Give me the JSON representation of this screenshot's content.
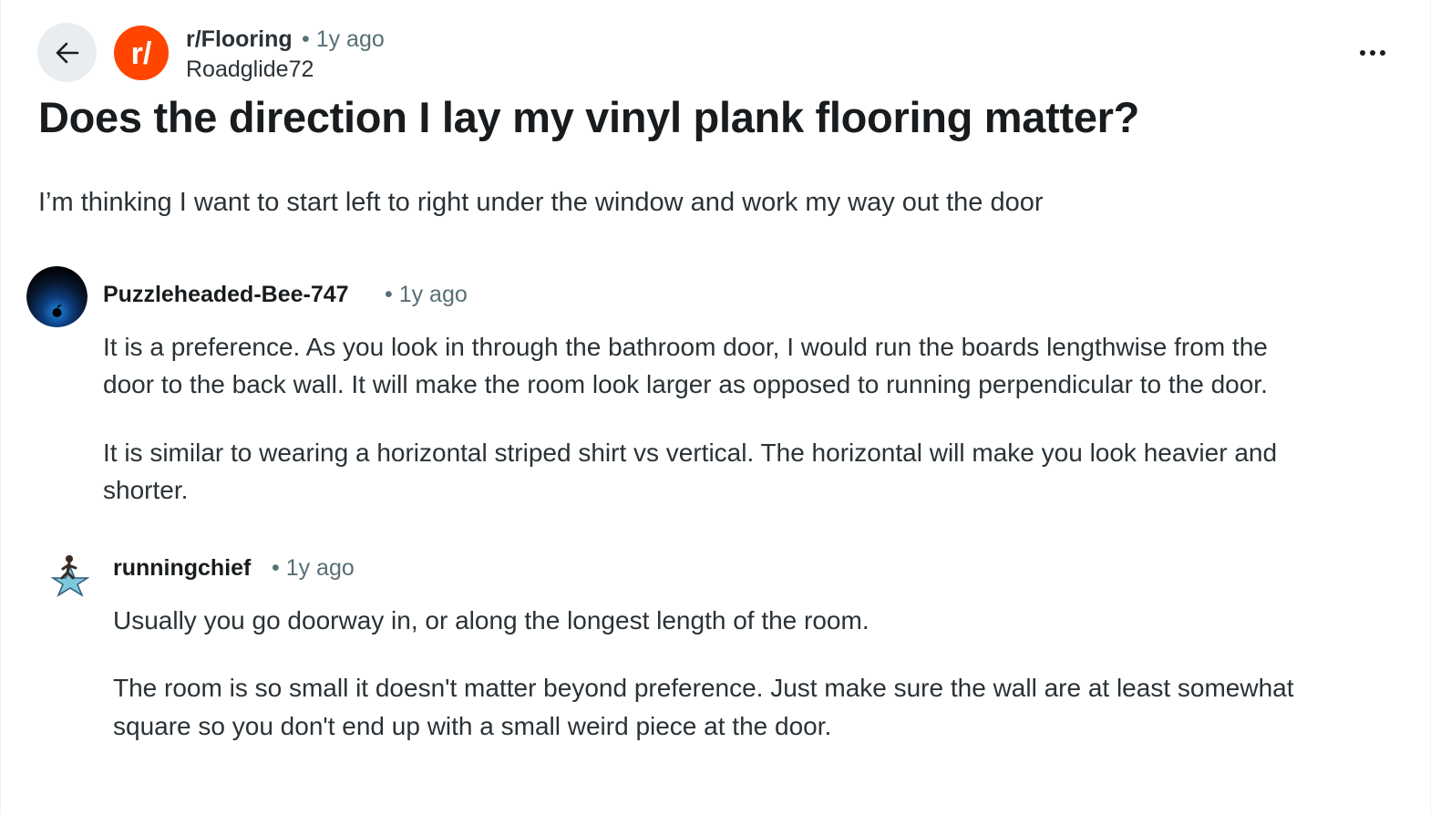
{
  "header": {
    "back_icon": "arrow-left-icon",
    "subreddit": "r/Flooring",
    "post_age": "• 1y ago",
    "author": "Roadglide72",
    "subreddit_icon_text": "r/",
    "subreddit_icon_color": "#ff4500",
    "more_icon": "more-horizontal-icon"
  },
  "post": {
    "title": "Does the direction I lay my vinyl plank flooring matter?",
    "body": "I’m thinking I want to start left to right under the window and work my way out the door"
  },
  "comments": [
    {
      "username": "Puzzleheaded-Bee-747",
      "age": "• 1y ago",
      "avatar_icon": "dark-planet-avatar",
      "paragraphs": [
        {
          "line1": "It is a preference. As you look in through the bathroom door, I would run the boards lengthwise from the",
          "line2": "door to the back wall. It will make the room look larger as opposed to running perpendicular to the door."
        },
        {
          "line1": "It is similar to wearing a horizontal striped shirt vs vertical. The horizontal will make you look heavier and",
          "line2": "shorter."
        }
      ]
    },
    {
      "username": "runningchief",
      "age": "• 1y ago",
      "avatar_icon": "runner-star-avatar",
      "paragraphs": [
        {
          "line1": "Usually you go doorway in, or along the longest length of the room."
        },
        {
          "line1": "The room is so small it doesn't matter beyond preference. Just make sure the wall are at least somewhat",
          "line2": "square so you don't end up with a small weird piece at the door."
        }
      ]
    }
  ]
}
